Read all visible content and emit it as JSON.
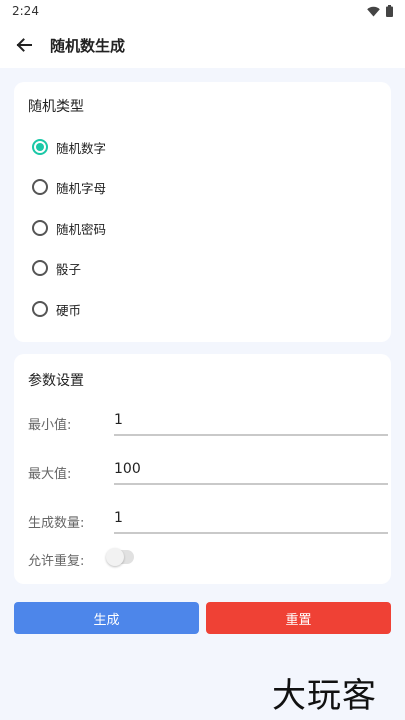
{
  "status": {
    "time": "2:24"
  },
  "appbar": {
    "title": "随机数生成"
  },
  "type_card": {
    "title": "随机类型",
    "options": [
      {
        "label": "随机数字",
        "selected": true
      },
      {
        "label": "随机字母",
        "selected": false
      },
      {
        "label": "随机密码",
        "selected": false
      },
      {
        "label": "骰子",
        "selected": false
      },
      {
        "label": "硬币",
        "selected": false
      }
    ]
  },
  "params_card": {
    "title": "参数设置",
    "min_label": "最小值:",
    "min_value": "1",
    "max_label": "最大值:",
    "max_value": "100",
    "count_label": "生成数量:",
    "count_value": "1",
    "repeat_label": "允许重复:",
    "repeat_enabled": false
  },
  "actions": {
    "generate_label": "生成",
    "reset_label": "重置"
  },
  "watermark": "大玩客",
  "colors": {
    "accent": "#1bc8a7",
    "generate": "#4d86ea",
    "reset": "#ef4135",
    "background": "#f3f6fd"
  }
}
